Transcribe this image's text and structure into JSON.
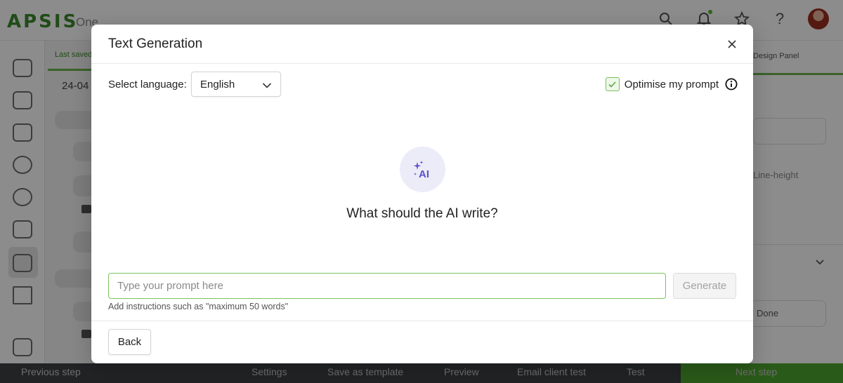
{
  "app": {
    "logo": "APSIS",
    "logo_sub": "One",
    "top_icons": [
      "search-icon",
      "bell-icon",
      "star-icon",
      "help-icon"
    ],
    "colors": {
      "brand": "#3b8a2b",
      "accent": "#6ab24b",
      "bottom_bar": "#3d4043",
      "next_step": "#4ea52f"
    }
  },
  "background": {
    "tab_label": "Last saved",
    "date_label": "24-04",
    "right_panel_tab": "Design Panel",
    "right_panel_text": "Line-height",
    "right_panel_button": "Done"
  },
  "bottom_bar": {
    "previous_step": "Previous step",
    "settings": "Settings",
    "save_as_template": "Save as template",
    "preview": "Preview",
    "email_client_test": "Email client test",
    "test": "Test",
    "next_step": "Next step"
  },
  "modal": {
    "title": "Text Generation",
    "language_label": "Select language:",
    "language_value": "English",
    "optimise_label": "Optimise my prompt",
    "optimise_checked": true,
    "ai_badge": "AI",
    "question": "What should the AI write?",
    "prompt_placeholder": "Type your prompt here",
    "prompt_value": "",
    "generate_label": "Generate",
    "hint": "Add instructions such as \"maximum 50 words\"",
    "back_label": "Back"
  }
}
